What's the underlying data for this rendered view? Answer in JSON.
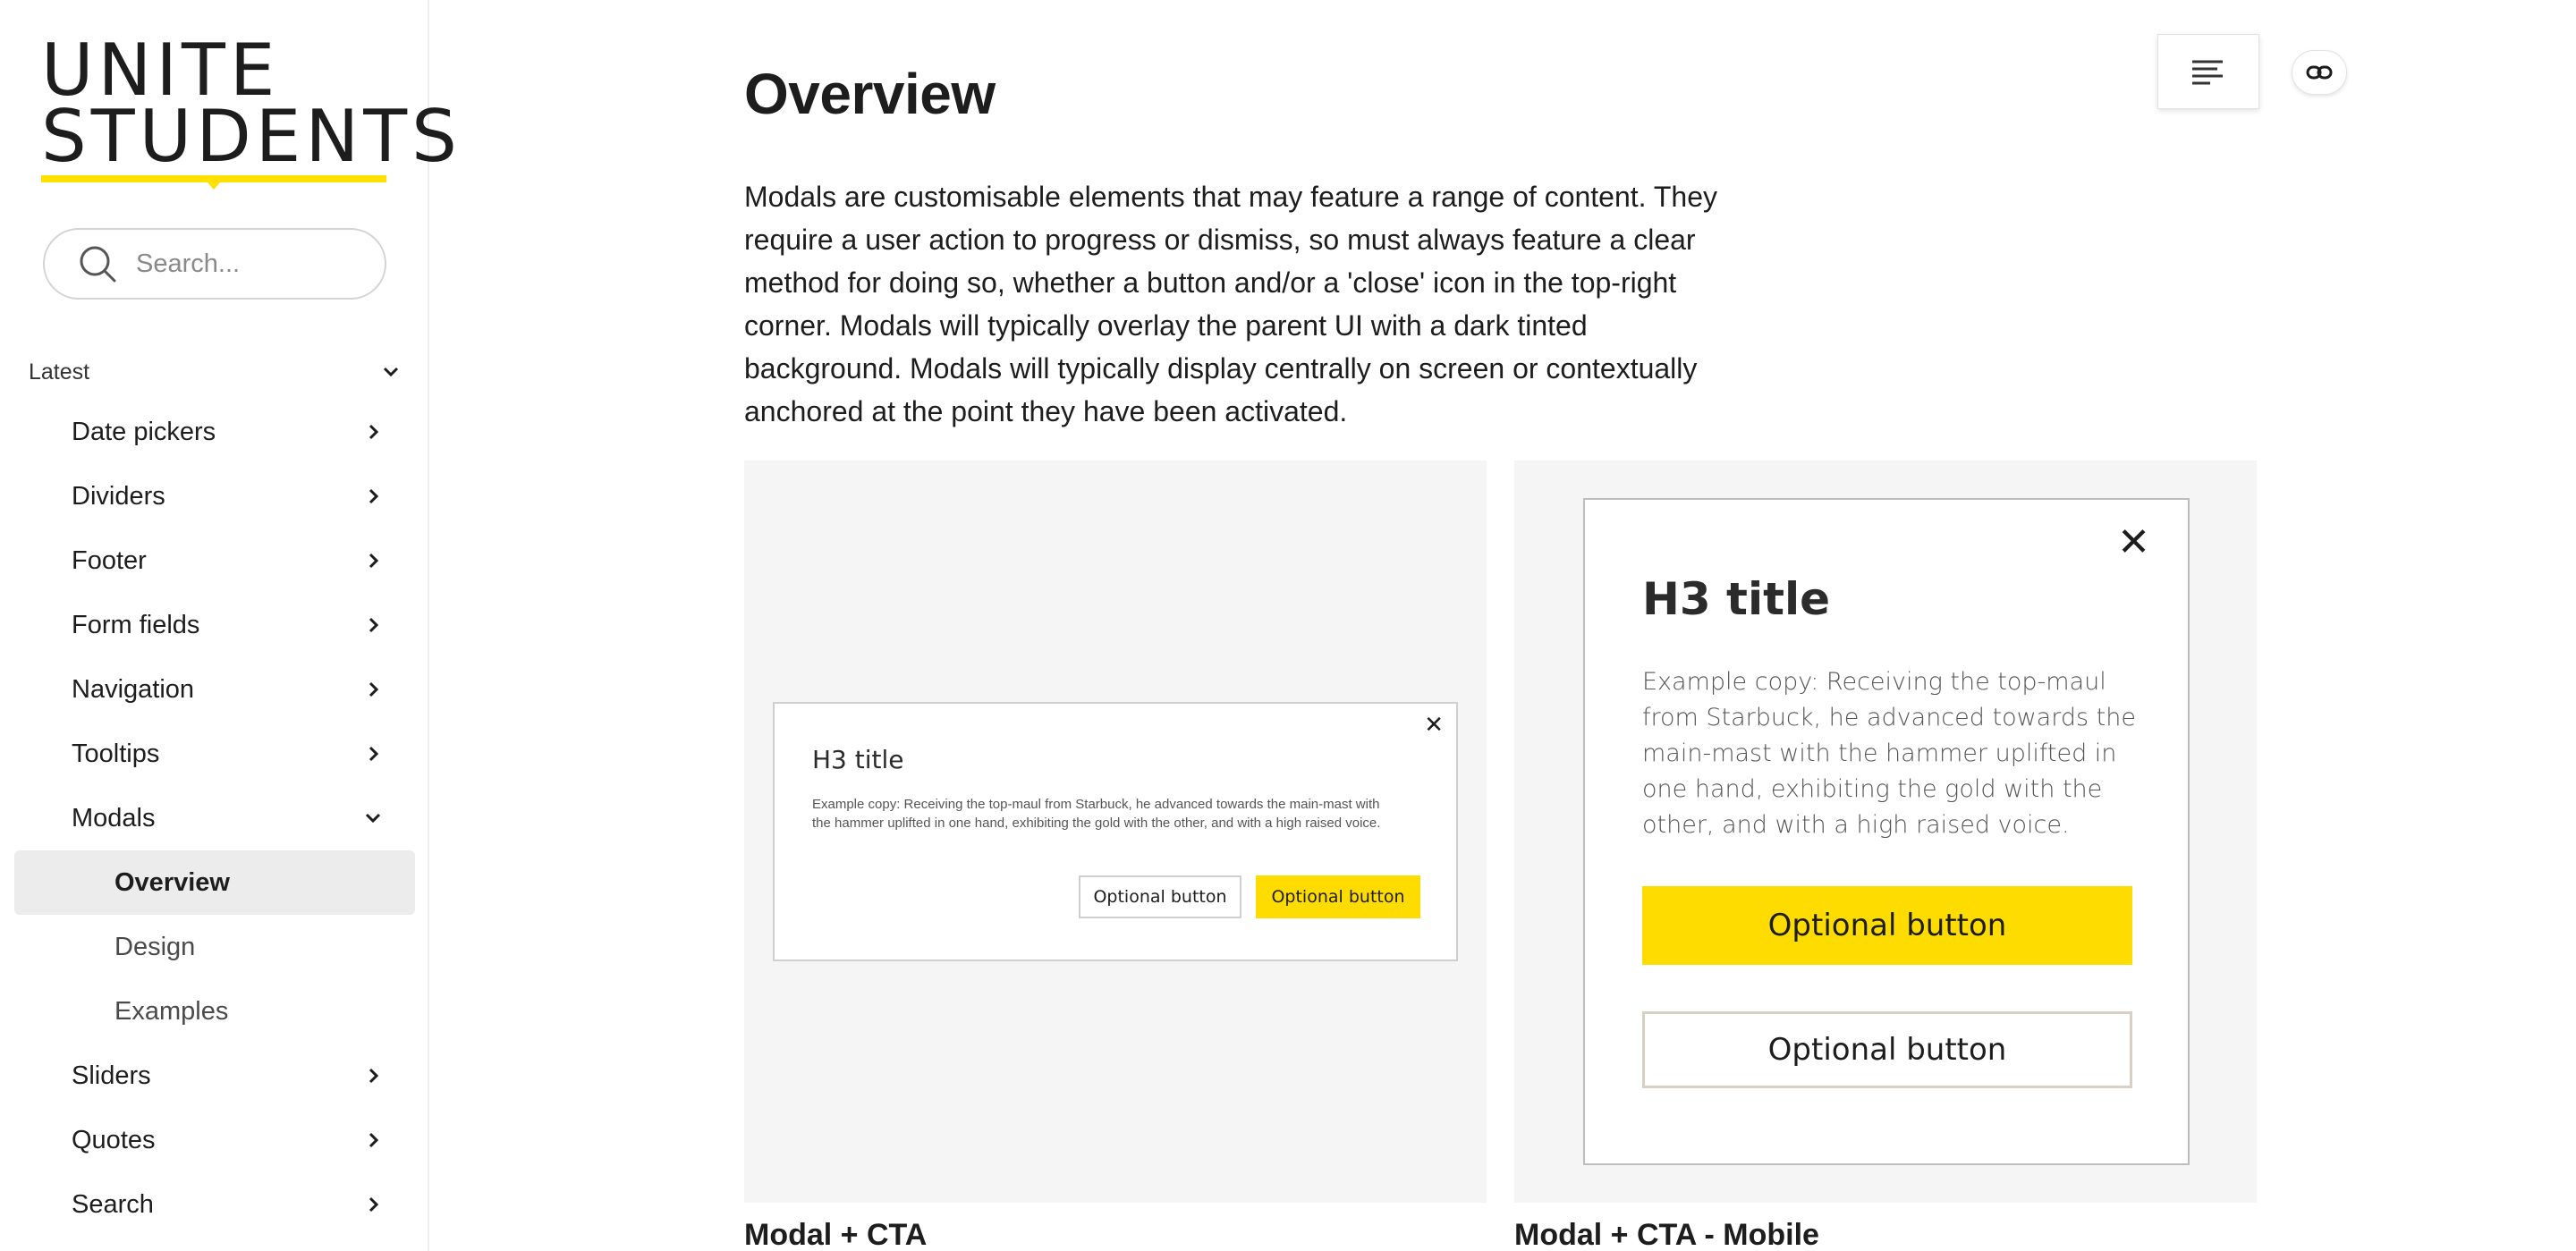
{
  "brand": {
    "logo_line1": "UNITE",
    "logo_line2": "STUDENTS",
    "accent_color": "#ffdc00"
  },
  "search": {
    "placeholder": "Search..."
  },
  "sidebar": {
    "section_label": "Latest",
    "items": [
      {
        "label": "Date pickers",
        "icon": "chevron-right-icon"
      },
      {
        "label": "Dividers",
        "icon": "chevron-right-icon"
      },
      {
        "label": "Footer",
        "icon": "chevron-right-icon"
      },
      {
        "label": "Form fields",
        "icon": "chevron-right-icon"
      },
      {
        "label": "Navigation",
        "icon": "chevron-right-icon"
      },
      {
        "label": "Tooltips",
        "icon": "chevron-right-icon"
      },
      {
        "label": "Modals",
        "icon": "chevron-down-icon",
        "expanded": true
      },
      {
        "label": "Overview",
        "sub": true,
        "active": true
      },
      {
        "label": "Design",
        "sub": true
      },
      {
        "label": "Examples",
        "sub": true
      },
      {
        "label": "Sliders",
        "icon": "chevron-right-icon"
      },
      {
        "label": "Quotes",
        "icon": "chevron-right-icon"
      },
      {
        "label": "Search",
        "icon": "chevron-right-icon"
      }
    ]
  },
  "main": {
    "title": "Overview",
    "intro": "Modals are customisable elements that may feature a range of content. They require a user action to progress or dismiss, so must always feature a clear method for doing so, whether a button and/or a 'close' icon in the top-right corner.  Modals will typically overlay the parent UI with a dark tinted background. Modals will typically display centrally on screen or contextually anchored at the point they have been activated.",
    "examples": [
      {
        "caption": "Modal + CTA",
        "modal_title": "H3 title",
        "modal_copy": "Example copy: Receiving the top-maul from Starbuck, he advanced towards the main-mast with the hammer uplifted in one hand, exhibiting the gold with the other, and with a high raised voice.",
        "button_secondary": "Optional button",
        "button_primary": "Optional button",
        "close_glyph": "✕"
      },
      {
        "caption": "Modal + CTA - Mobile",
        "modal_title": "H3 title",
        "modal_copy": "Example copy: Receiving the top-maul from Starbuck, he advanced towards the main-mast with the hammer uplifted in one hand, exhibiting the gold with the other, and with a high raised voice.",
        "button_primary": "Optional button",
        "button_secondary": "Optional button",
        "close_glyph": "✕"
      }
    ]
  },
  "toolbar": {
    "toc_icon": "table-of-contents-icon",
    "link_icon": "link-icon"
  }
}
